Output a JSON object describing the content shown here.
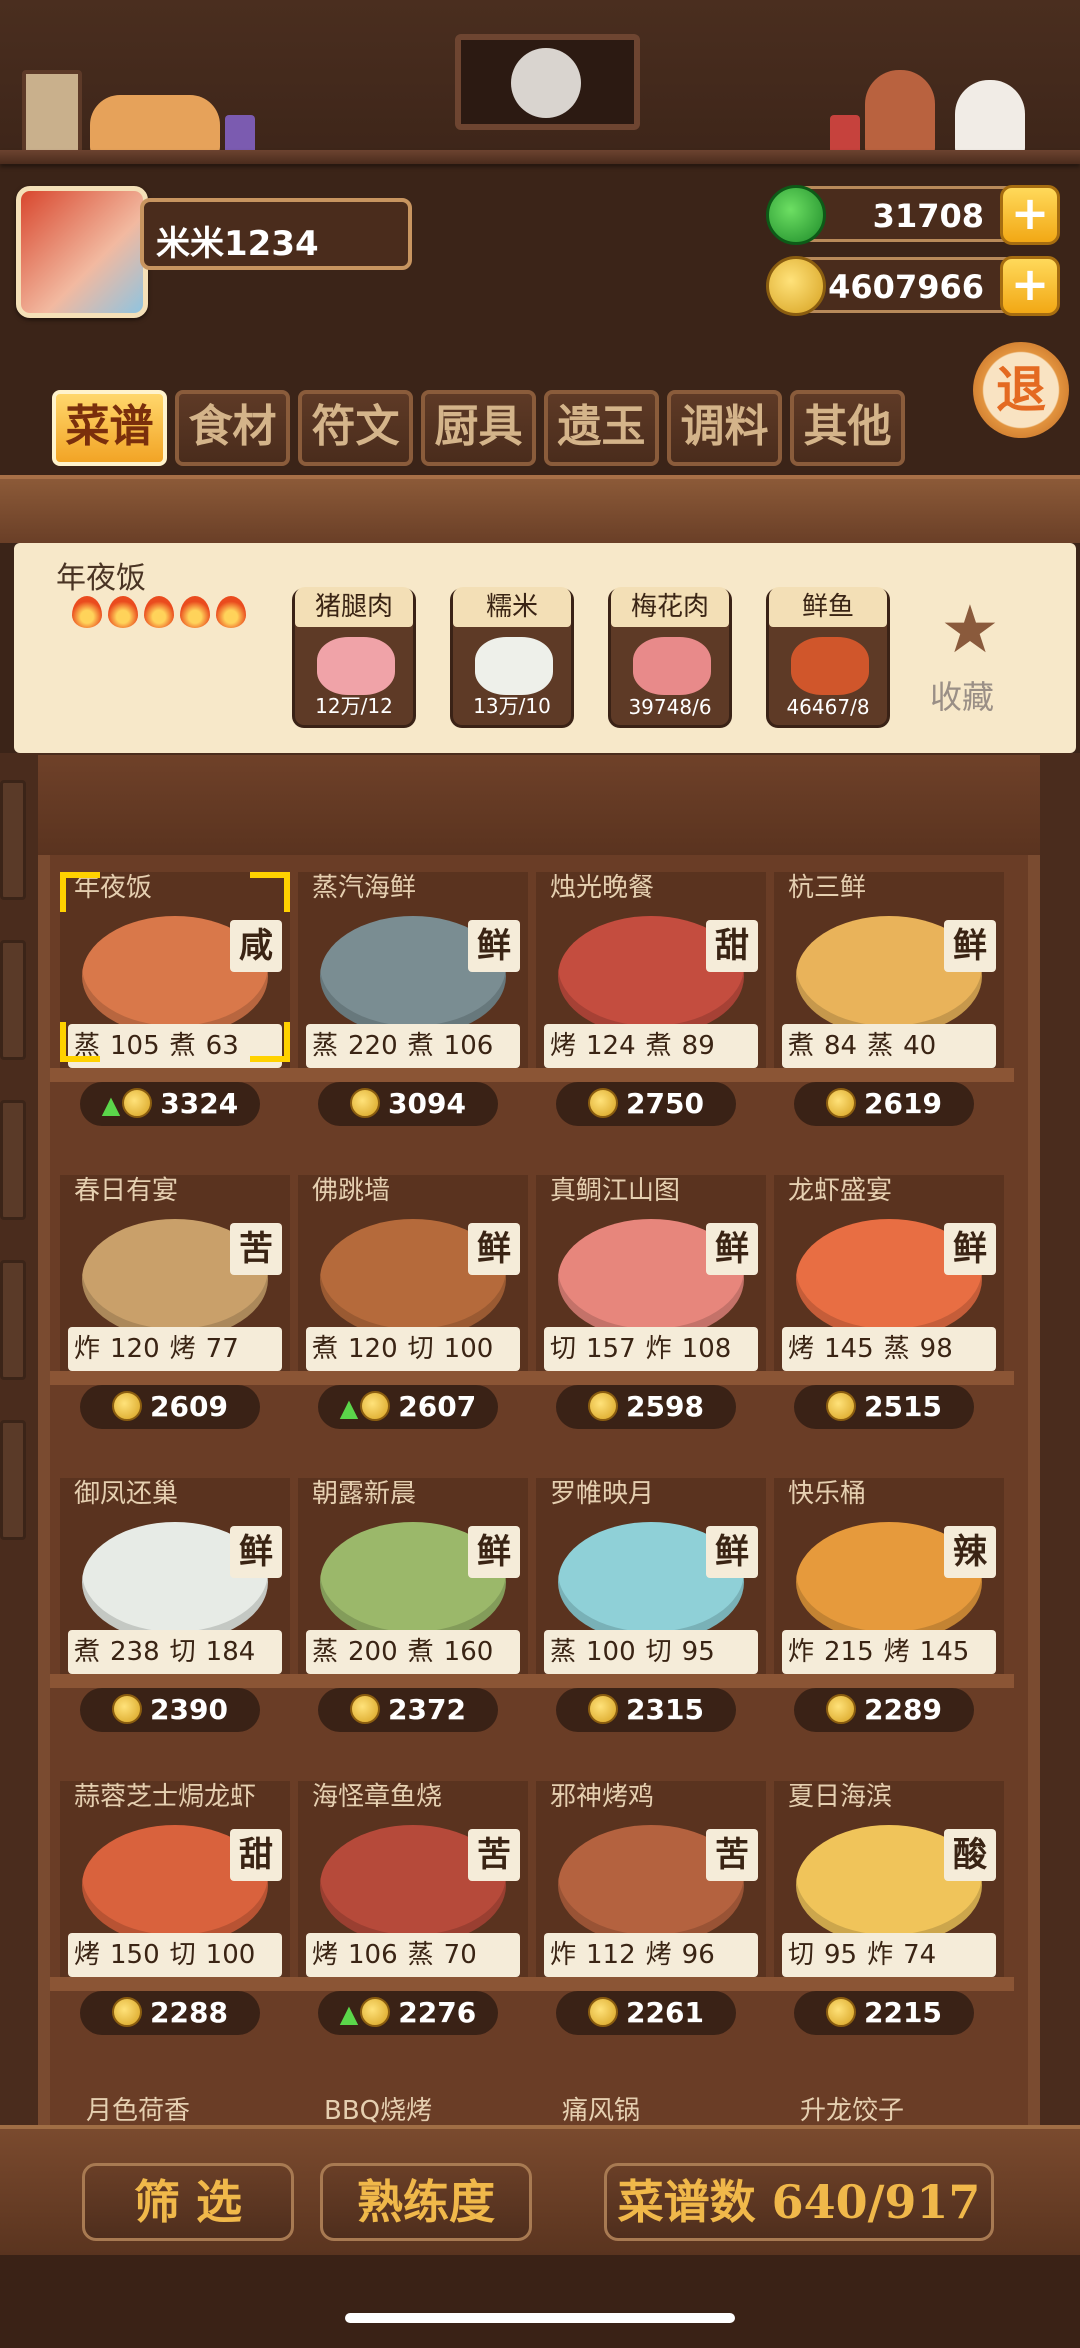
{
  "player": {
    "name": "米米1234"
  },
  "currency": {
    "jade": "31708",
    "coins": "4607966",
    "plus": "+"
  },
  "exit_label": "退",
  "tabs": [
    "菜谱",
    "食材",
    "符文",
    "厨具",
    "遗玉",
    "调料",
    "其他"
  ],
  "active_tab": 0,
  "selected_recipe": {
    "name": "年夜饭",
    "stars": 5,
    "ingredients": [
      {
        "name": "猪腿肉",
        "count": "12万/12"
      },
      {
        "name": "糯米",
        "count": "13万/10"
      },
      {
        "name": "梅花肉",
        "count": "39748/6"
      },
      {
        "name": "鲜鱼",
        "count": "46467/8"
      }
    ],
    "favorite_label": "收藏"
  },
  "recipes": [
    {
      "name": "年夜饭",
      "flavor": "咸",
      "s1": "蒸",
      "v1": "105",
      "s2": "煮",
      "v2": "63",
      "price": "3324",
      "up": true
    },
    {
      "name": "蒸汽海鲜",
      "flavor": "鲜",
      "s1": "蒸",
      "v1": "220",
      "s2": "煮",
      "v2": "106",
      "price": "3094",
      "up": false
    },
    {
      "name": "烛光晚餐",
      "flavor": "甜",
      "s1": "烤",
      "v1": "124",
      "s2": "煮",
      "v2": "89",
      "price": "2750",
      "up": false
    },
    {
      "name": "杭三鲜",
      "flavor": "鲜",
      "s1": "煮",
      "v1": "84",
      "s2": "蒸",
      "v2": "40",
      "price": "2619",
      "up": false
    },
    {
      "name": "春日有宴",
      "flavor": "苦",
      "s1": "炸",
      "v1": "120",
      "s2": "烤",
      "v2": "77",
      "price": "2609",
      "up": false
    },
    {
      "name": "佛跳墙",
      "flavor": "鲜",
      "s1": "煮",
      "v1": "120",
      "s2": "切",
      "v2": "100",
      "price": "2607",
      "up": true
    },
    {
      "name": "真鲷江山图",
      "flavor": "鲜",
      "s1": "切",
      "v1": "157",
      "s2": "炸",
      "v2": "108",
      "price": "2598",
      "up": false
    },
    {
      "name": "龙虾盛宴",
      "flavor": "鲜",
      "s1": "烤",
      "v1": "145",
      "s2": "蒸",
      "v2": "98",
      "price": "2515",
      "up": false
    },
    {
      "name": "御凤还巢",
      "flavor": "鲜",
      "s1": "煮",
      "v1": "238",
      "s2": "切",
      "v2": "184",
      "price": "2390",
      "up": false
    },
    {
      "name": "朝露新晨",
      "flavor": "鲜",
      "s1": "蒸",
      "v1": "200",
      "s2": "煮",
      "v2": "160",
      "price": "2372",
      "up": false
    },
    {
      "name": "罗帷映月",
      "flavor": "鲜",
      "s1": "蒸",
      "v1": "100",
      "s2": "切",
      "v2": "95",
      "price": "2315",
      "up": false
    },
    {
      "name": "快乐桶",
      "flavor": "辣",
      "s1": "炸",
      "v1": "215",
      "s2": "烤",
      "v2": "145",
      "price": "2289",
      "up": false
    },
    {
      "name": "蒜蓉芝士焗龙虾",
      "flavor": "甜",
      "s1": "烤",
      "v1": "150",
      "s2": "切",
      "v2": "100",
      "price": "2288",
      "up": false
    },
    {
      "name": "海怪章鱼烧",
      "flavor": "苦",
      "s1": "烤",
      "v1": "106",
      "s2": "蒸",
      "v2": "70",
      "price": "2276",
      "up": true
    },
    {
      "name": "邪神烤鸡",
      "flavor": "苦",
      "s1": "炸",
      "v1": "112",
      "s2": "烤",
      "v2": "96",
      "price": "2261",
      "up": false
    },
    {
      "name": "夏日海滨",
      "flavor": "酸",
      "s1": "切",
      "v1": "95",
      "s2": "炸",
      "v2": "74",
      "price": "2215",
      "up": false
    }
  ],
  "next_row": [
    "月色荷香",
    "BBQ烧烤",
    "痛风锅",
    "升龙饺子"
  ],
  "bottom": {
    "filter": "筛 选",
    "proficiency": "熟练度",
    "count": "菜谱数 640/917"
  },
  "colors": {
    "accent": "#f2a425",
    "wood": "#6a3d26",
    "panel": "#f7e8c9"
  }
}
